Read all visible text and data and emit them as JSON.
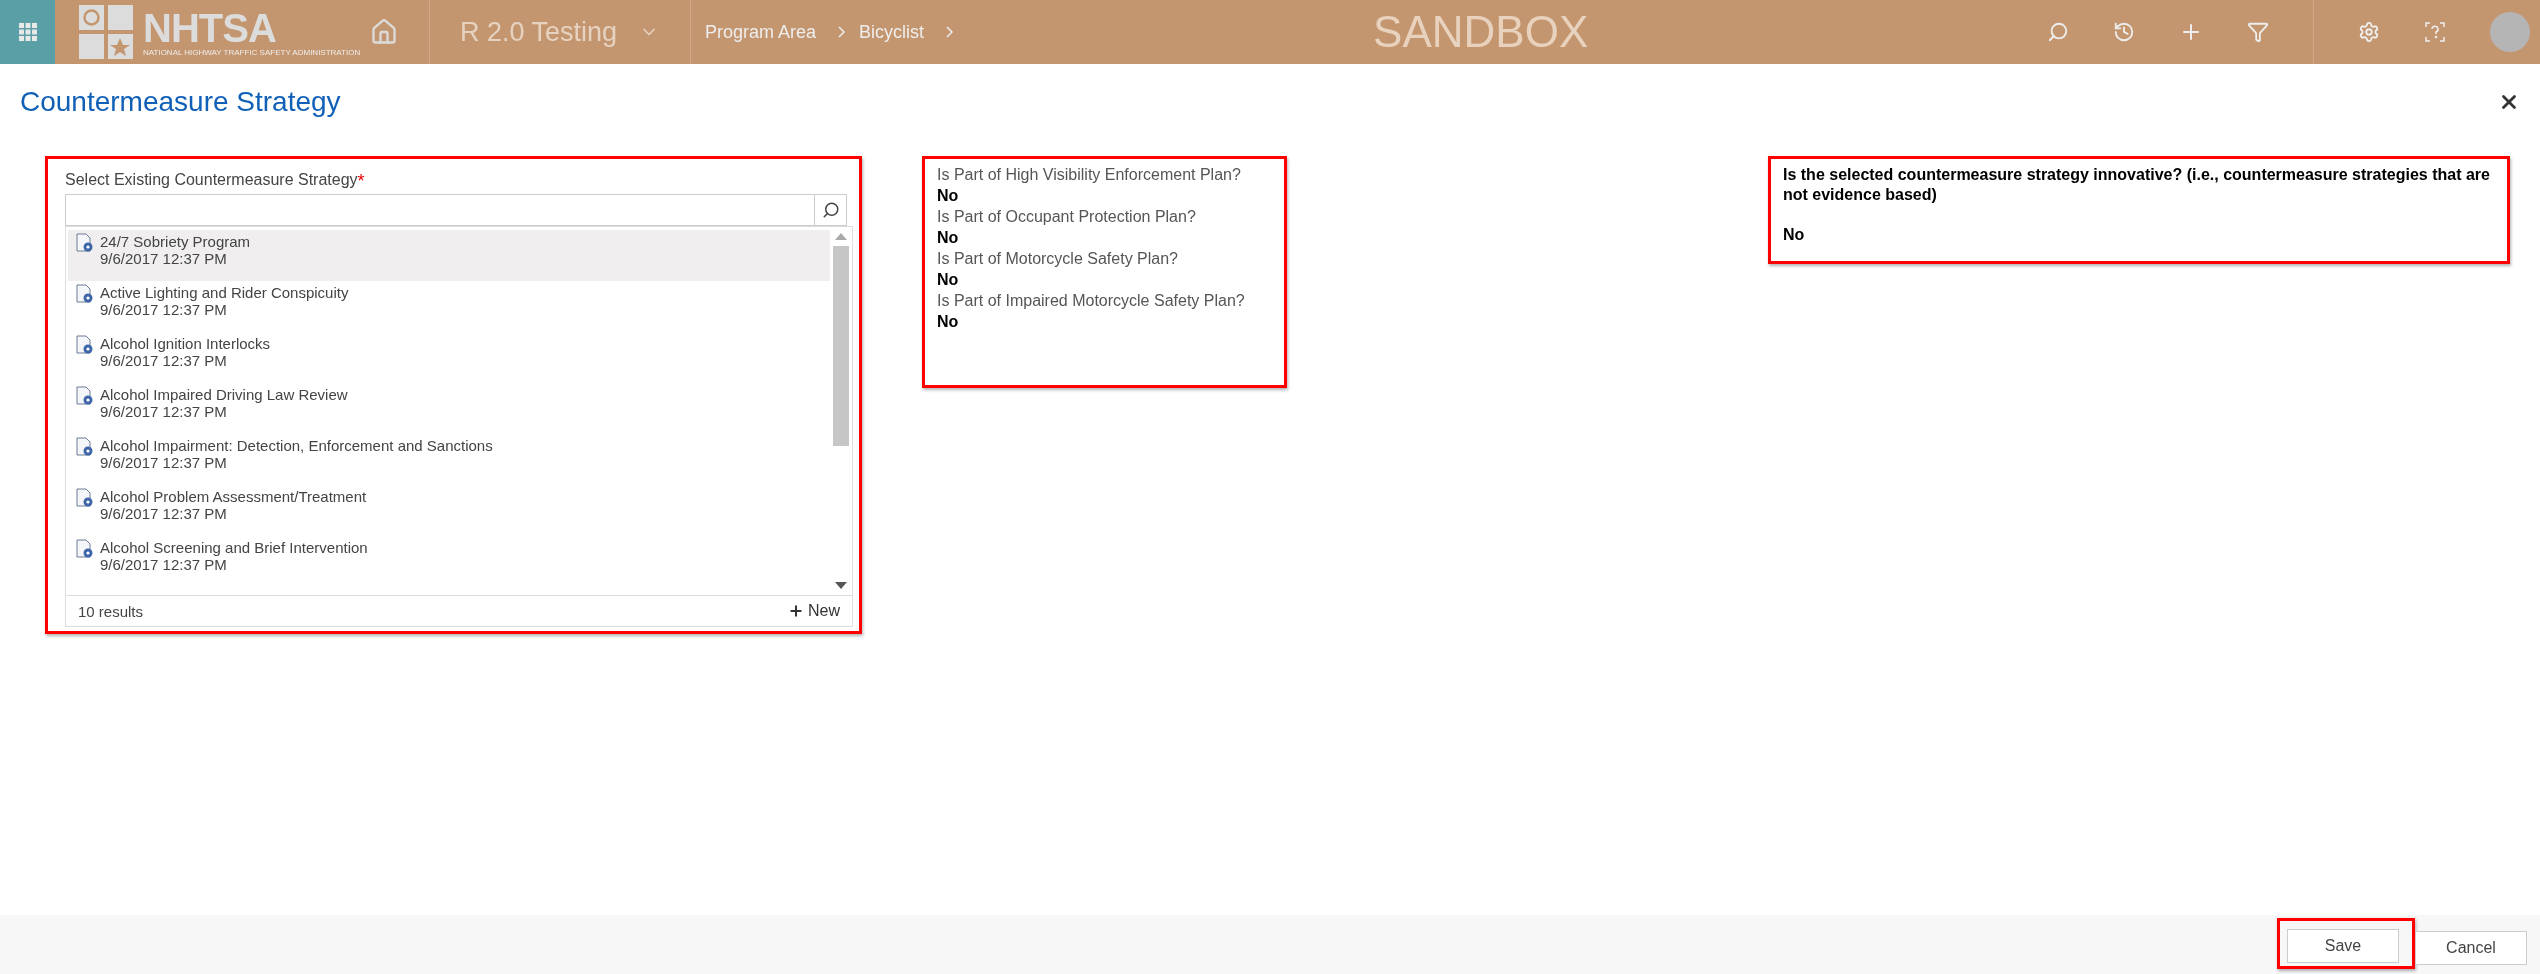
{
  "top_bar": {
    "logo": {
      "name": "NHTSA",
      "subtitle": "NATIONAL HIGHWAY TRAFFIC SAFETY ADMINISTRATION"
    },
    "app_name": "R 2.0 Testing",
    "breadcrumbs": [
      "Program Area",
      "Bicyclist"
    ],
    "environment": "SANDBOX"
  },
  "dialog": {
    "title": "Countermeasure Strategy",
    "lookup": {
      "label": "Select Existing Countermeasure Strategy",
      "required_mark": "*",
      "results": [
        {
          "name": "24/7 Sobriety Program",
          "date": "9/6/2017 12:37 PM",
          "selected": true
        },
        {
          "name": "Active Lighting and Rider Conspicuity",
          "date": "9/6/2017 12:37 PM",
          "selected": false
        },
        {
          "name": "Alcohol Ignition Interlocks",
          "date": "9/6/2017 12:37 PM",
          "selected": false
        },
        {
          "name": "Alcohol Impaired Driving Law Review",
          "date": "9/6/2017 12:37 PM",
          "selected": false
        },
        {
          "name": "Alcohol Impairment: Detection, Enforcement and Sanctions",
          "date": "9/6/2017 12:37 PM",
          "selected": false
        },
        {
          "name": "Alcohol Problem Assessment/Treatment",
          "date": "9/6/2017 12:37 PM",
          "selected": false
        },
        {
          "name": "Alcohol Screening and Brief Intervention",
          "date": "9/6/2017 12:37 PM",
          "selected": false
        }
      ],
      "count": "10 results",
      "new_label": "New"
    },
    "plans": [
      {
        "label": "Is Part of High Visibility Enforcement Plan?",
        "value": "No"
      },
      {
        "label": "Is Part of Occupant Protection Plan?",
        "value": "No"
      },
      {
        "label": "Is Part of Motorcycle Safety Plan?",
        "value": "No"
      },
      {
        "label": "Is Part of Impaired Motorcycle Safety Plan?",
        "value": "No"
      }
    ],
    "innovative": {
      "question": "Is the selected countermeasure strategy innovative? (i.e., countermeasure strategies that are not evidence based)",
      "value": "No"
    },
    "buttons": [
      "Save",
      "Cancel"
    ]
  }
}
